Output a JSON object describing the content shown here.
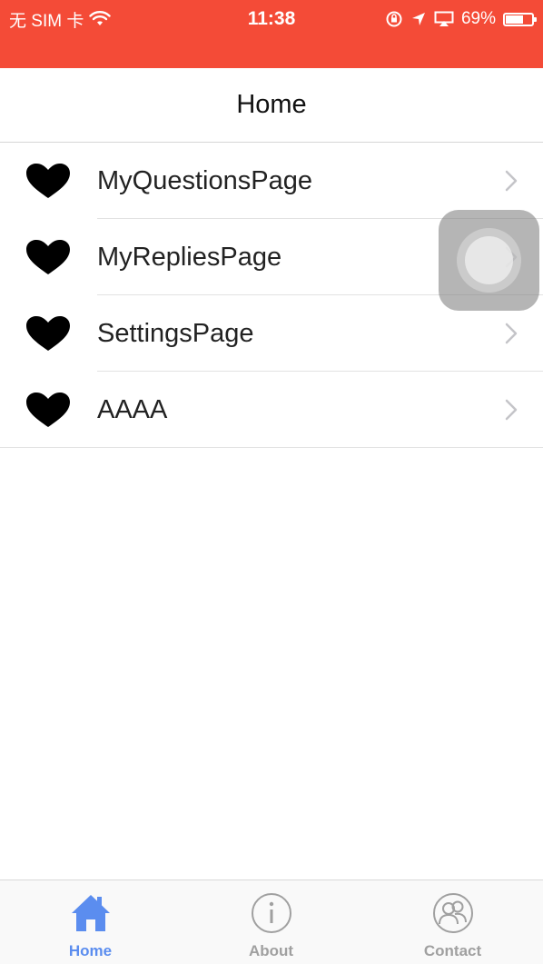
{
  "status_bar": {
    "carrier": "无 SIM 卡",
    "time": "11:38",
    "battery_percent": "69%",
    "battery_level": 0.69,
    "icons": [
      "wifi-icon",
      "orientation-lock-icon",
      "location-arrow-icon",
      "airplay-icon",
      "battery-icon"
    ]
  },
  "nav": {
    "title": "Home"
  },
  "list": {
    "items": [
      {
        "label": "MyQuestionsPage",
        "icon": "heart-icon"
      },
      {
        "label": "MyRepliesPage",
        "icon": "heart-icon"
      },
      {
        "label": "SettingsPage",
        "icon": "heart-icon"
      },
      {
        "label": "AAAA",
        "icon": "heart-icon"
      }
    ]
  },
  "tabs": [
    {
      "label": "Home",
      "icon": "home-icon",
      "active": true
    },
    {
      "label": "About",
      "icon": "info-icon",
      "active": false
    },
    {
      "label": "Contact",
      "icon": "contacts-icon",
      "active": false
    }
  ],
  "colors": {
    "status_bar_bg": "#f44b37",
    "tab_active": "#5b8def",
    "tab_inactive": "#a0a0a0"
  }
}
